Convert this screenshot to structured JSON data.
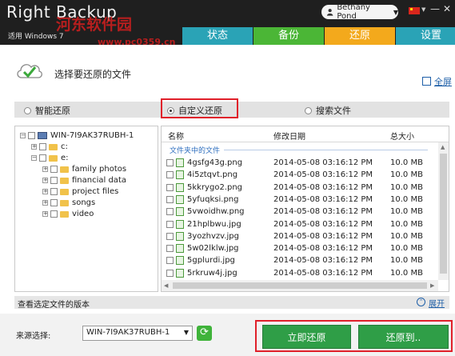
{
  "window": {
    "app_title": "Right Backup",
    "os_label": "适用 Windows 7",
    "watermark": "河东软件园",
    "watermark_url": "www.pc0359.cn",
    "user_name": "Bethany Pond",
    "minimize": "—",
    "close": "✕"
  },
  "tabs": [
    {
      "label": "状态"
    },
    {
      "label": "备份"
    },
    {
      "label": "还原",
      "active": true
    },
    {
      "label": "设置"
    }
  ],
  "page": {
    "title": "选择要还原的文件",
    "fullscreen": "全屏"
  },
  "options": {
    "smart": "智能还原",
    "custom": "自定义还原",
    "search": "搜索文件",
    "selected": "custom"
  },
  "tree": {
    "root": "WIN-7I9AK37RUBH-1",
    "drives": [
      "c:",
      "e:"
    ],
    "folders": [
      "family photos",
      "financial data",
      "project files",
      "songs",
      "video"
    ]
  },
  "files": {
    "headers": {
      "name": "名称",
      "date": "修改日期",
      "size": "总大小"
    },
    "group": "文件夹中的文件",
    "rows": [
      {
        "name": "4gsfg43g.png",
        "date": "2014-05-08 03:16:12 PM",
        "size": "10.0 MB"
      },
      {
        "name": "4i5ztqvt.png",
        "date": "2014-05-08 03:16:12 PM",
        "size": "10.0 MB"
      },
      {
        "name": "5kkrygo2.png",
        "date": "2014-05-08 03:16:12 PM",
        "size": "10.0 MB"
      },
      {
        "name": "5yfuqksi.png",
        "date": "2014-05-08 03:16:12 PM",
        "size": "10.0 MB"
      },
      {
        "name": "5vwoidhw.png",
        "date": "2014-05-08 03:16:12 PM",
        "size": "10.0 MB"
      },
      {
        "name": "21hplbwu.jpg",
        "date": "2014-05-08 03:16:12 PM",
        "size": "10.0 MB"
      },
      {
        "name": "3yozhvzv.jpg",
        "date": "2014-05-08 03:16:12 PM",
        "size": "10.0 MB"
      },
      {
        "name": "5w02lklw.jpg",
        "date": "2014-05-08 03:16:12 PM",
        "size": "10.0 MB"
      },
      {
        "name": "5gplurdi.jpg",
        "date": "2014-05-08 03:16:12 PM",
        "size": "10.0 MB"
      },
      {
        "name": "5rkruw4j.jpg",
        "date": "2014-05-08 03:16:12 PM",
        "size": "10.0 MB"
      }
    ]
  },
  "versions": {
    "label": "查看选定文件的版本",
    "expand": "展开"
  },
  "bottom": {
    "source_label": "来源选择:",
    "source_value": "WIN-7I9AK37RUBH-1",
    "restore_now": "立即还原",
    "restore_to": "还原到.."
  },
  "colors": {
    "tab_status": "#2aa3b6",
    "tab_backup": "#4bb636",
    "tab_restore": "#f3a91c",
    "tab_settings": "#2aa3b6",
    "button_green": "#2f9e47",
    "highlight_red": "#e0202a"
  }
}
